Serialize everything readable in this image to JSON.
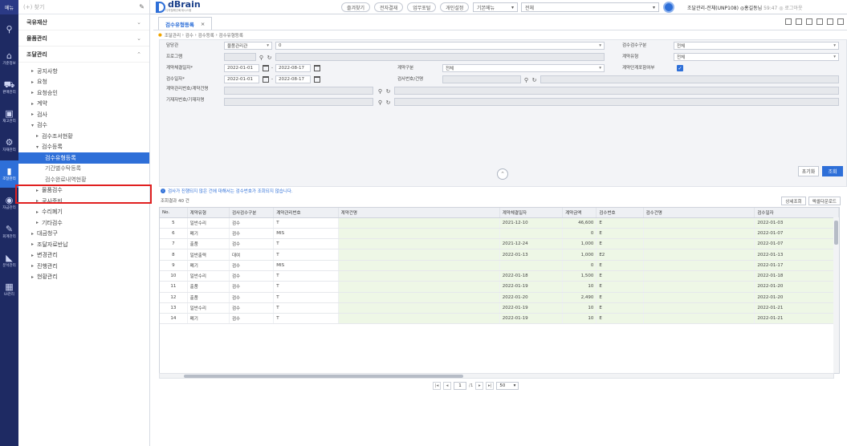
{
  "rail": {
    "top_label": "메뉴",
    "items": [
      {
        "label": "",
        "icon": "search-icon"
      },
      {
        "label": "기준정보",
        "icon": "home-icon"
      },
      {
        "label": "판매관리",
        "icon": "cart-icon"
      },
      {
        "label": "재고관리",
        "icon": "box-icon"
      },
      {
        "label": "자재관리",
        "icon": "gear-icon"
      },
      {
        "label": "조달관리",
        "icon": "building-icon",
        "active": true
      },
      {
        "label": "자금관리",
        "icon": "coin-icon"
      },
      {
        "label": "회계관리",
        "icon": "doc-icon"
      },
      {
        "label": "분석관리",
        "icon": "chart-icon"
      },
      {
        "label": "UI관리",
        "icon": "layers-icon"
      }
    ]
  },
  "menu": {
    "search_placeholder": "(+) 찾기",
    "sections": [
      {
        "label": "국유재산",
        "chev": "⌄"
      },
      {
        "label": "물품관리",
        "chev": "⌄"
      },
      {
        "label": "조달관리",
        "chev": "⌃"
      }
    ],
    "items": [
      {
        "label": "공지사항",
        "level": 1,
        "arrow": "▸"
      },
      {
        "label": "요청",
        "level": 1,
        "arrow": "▸"
      },
      {
        "label": "요청승인",
        "level": 1,
        "arrow": "▸"
      },
      {
        "label": "계약",
        "level": 1,
        "arrow": "▸"
      },
      {
        "label": "검사",
        "level": 1,
        "arrow": "▸"
      },
      {
        "label": "검수",
        "level": 1,
        "arrow": "▾"
      },
      {
        "label": "검수조서현황",
        "level": 2,
        "arrow": "▸"
      },
      {
        "label": "검수등록",
        "level": 2,
        "arrow": "▾"
      },
      {
        "label": "검수유형등록",
        "level": 3,
        "arrow": "",
        "selected": true
      },
      {
        "label": "기간별수탁등록",
        "level": 3,
        "arrow": ""
      },
      {
        "label": "검수완료내역현황",
        "level": 3,
        "arrow": ""
      },
      {
        "label": "물품검수",
        "level": 2,
        "arrow": "▸"
      },
      {
        "label": "공사준비",
        "level": 2,
        "arrow": "▸"
      },
      {
        "label": "수리폐기",
        "level": 2,
        "arrow": "▸"
      },
      {
        "label": "기타검수",
        "level": 2,
        "arrow": "▸"
      },
      {
        "label": "대금청구",
        "level": 1,
        "arrow": "▸"
      },
      {
        "label": "조달자료반납",
        "level": 1,
        "arrow": "▸"
      },
      {
        "label": "변경관리",
        "level": 1,
        "arrow": "▸"
      },
      {
        "label": "진행관리",
        "level": 1,
        "arrow": "▸"
      },
      {
        "label": "현황관리",
        "level": 1,
        "arrow": "▸"
      }
    ]
  },
  "topbar": {
    "logo": "dBrain",
    "logo_sub": "디지털예산회계시스템",
    "buttons": [
      "즐겨찾기",
      "전자결재",
      "업무포털",
      "개인설정"
    ],
    "select1": "기본메뉴",
    "select2": "전체",
    "user": "조달관리-전체(UNP108) ◎홍길동님",
    "user_extra": "59:47 ◎ 로그아웃"
  },
  "tab": {
    "label": "검수유형등록",
    "close": "×"
  },
  "breadcrumb": [
    "조달관리",
    "검수",
    "검수등록",
    "검수유형등록"
  ],
  "form": {
    "labels": {
      "org": "담당관",
      "program": "프로그램",
      "contract_date": "계약체결일자*",
      "inspect_date": "검수일자*",
      "contract_no": "계약관리번호/계약건명",
      "asset_no": "기재자번호/기재자명",
      "inspect_type": "검수검수구분",
      "contract_type": "계약유형",
      "contract_kind": "계약구분",
      "inspect_no": "검사번호/건명",
      "include_done": "계약단계포함여부"
    },
    "org_value": "물품관리관",
    "org_code": "0",
    "contract_from": "2022-01-01",
    "contract_to": "2022-08-17",
    "inspect_from": "2022-01-01",
    "inspect_to": "2022-08-17",
    "contract_kind_value": "전체",
    "inspect_type_value": "전체",
    "contract_type_value": "전체",
    "reset": "초기화",
    "search": "조회"
  },
  "notice": "검사가 진행되지 않은 건에 대해서는 검수번호가 조회되지 않습니다.",
  "count": "조회결과 40 건",
  "grid_buttons": [
    "상세조회",
    "엑셀다운로드"
  ],
  "grid": {
    "headers": [
      "No.",
      "계약유형",
      "검사검수구분",
      "계약관리번호",
      "계약건명",
      "계약체결일자",
      "계약금액",
      "검수번호",
      "검수건명",
      "검수일자"
    ],
    "rows": [
      [
        "5",
        "일반수리",
        "검수",
        "T",
        "",
        "2021-12-10",
        "46,600",
        "E",
        "",
        "2022-01-03"
      ],
      [
        "6",
        "폐기",
        "검수",
        "MIS",
        "",
        "",
        "0",
        "E",
        "",
        "2022-01-07"
      ],
      [
        "7",
        "출품",
        "검수",
        "T",
        "",
        "2021-12-24",
        "1,000",
        "E",
        "",
        "2022-01-07"
      ],
      [
        "8",
        "일반출력",
        "대여",
        "T",
        "",
        "2022-01-13",
        "1,000",
        "E2",
        "",
        "2022-01-13"
      ],
      [
        "9",
        "폐기",
        "검수",
        "MIS",
        "",
        "",
        "0",
        "E",
        "",
        "2022-01-17"
      ],
      [
        "10",
        "일반수리",
        "검수",
        "T",
        "",
        "2022-01-18",
        "1,500",
        "E",
        "",
        "2022-01-18"
      ],
      [
        "11",
        "출품",
        "검수",
        "T",
        "",
        "2022-01-19",
        "10",
        "E",
        "",
        "2022-01-20"
      ],
      [
        "12",
        "출품",
        "검수",
        "T",
        "",
        "2022-01-20",
        "2,490",
        "E",
        "",
        "2022-01-20"
      ],
      [
        "13",
        "일반수리",
        "검수",
        "T",
        "",
        "2022-01-19",
        "10",
        "E",
        "",
        "2022-01-21"
      ],
      [
        "14",
        "폐기",
        "검수",
        "T",
        "",
        "2022-01-19",
        "10",
        "E",
        "",
        "2022-01-21"
      ]
    ]
  },
  "pager": {
    "first": "|◂",
    "prev": "◂",
    "page": "1",
    "total": "/1",
    "next": "▸",
    "last": "▸|",
    "size": "50"
  }
}
